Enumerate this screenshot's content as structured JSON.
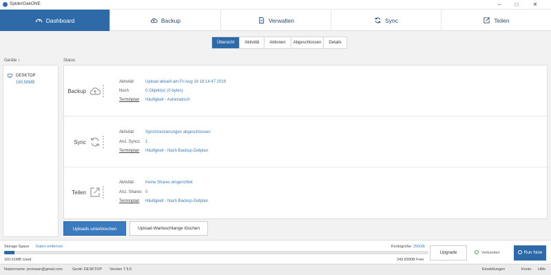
{
  "window": {
    "title": "SpiderOakONE",
    "controls": [
      "–",
      "□",
      "✕"
    ]
  },
  "nav": {
    "tabs": [
      {
        "label": "Dashboard",
        "icon": "dashboard-gauge-icon",
        "active": true
      },
      {
        "label": "Backup",
        "icon": "cloud-upload-icon",
        "active": false
      },
      {
        "label": "Verwalten",
        "icon": "document-icon",
        "active": false
      },
      {
        "label": "Sync",
        "icon": "sync-arrows-icon",
        "active": false
      },
      {
        "label": "Teilen",
        "icon": "share-external-icon",
        "active": false
      }
    ]
  },
  "subtabs": [
    {
      "label": "Übersicht",
      "active": true
    },
    {
      "label": "Aktivität",
      "active": false
    },
    {
      "label": "Aktionen",
      "active": false
    },
    {
      "label": "Abgeschlossen",
      "active": false
    },
    {
      "label": "Details",
      "active": false
    }
  ],
  "devices": {
    "header": "Geräte ↕",
    "items": [
      {
        "name": "DESKTOP",
        "size": "160,58MB",
        "icon": "desktop-device-icon"
      }
    ]
  },
  "status": {
    "header": "Status",
    "sections": [
      {
        "label": "Backup",
        "icon": "cloud-upload-icon",
        "rows": [
          {
            "key": "Aktivität",
            "value": "Upload aktuell am Fri Aug 16 18:14:47 2019",
            "link": false
          },
          {
            "key": "Noch",
            "value": "0 Objekt(e) (0 bytes)",
            "link": false
          },
          {
            "key": "Terminplan",
            "value": "Häufigkeit - Automatisch",
            "link": true
          }
        ]
      },
      {
        "label": "Sync",
        "icon": "sync-arrows-icon",
        "rows": [
          {
            "key": "Aktivität",
            "value": "Synchronisierungen abgeschlossen",
            "link": false
          },
          {
            "key": "Anz. Syncs",
            "value": "1",
            "link": false
          },
          {
            "key": "Terminplan",
            "value": "Häufigkeit - Nach Backup-Zeitplan",
            "link": true
          }
        ]
      },
      {
        "label": "Teilen",
        "icon": "share-external-icon",
        "rows": [
          {
            "key": "Aktivität",
            "value": "Keine Shares eingerichtet",
            "link": false
          },
          {
            "key": "Anz. Shares",
            "value": "0",
            "link": false
          },
          {
            "key": "Terminplan",
            "value": "Häufigkeit - Nach Backup-Zeitplan",
            "link": true
          }
        ]
      }
    ]
  },
  "actions": {
    "pause_uploads": "Uploads unterbrechen",
    "clear_queue": "Upload-Warteschlange löschen"
  },
  "storage": {
    "label": "Storage Space",
    "remove_link": "Daten entfernen",
    "quota_label": "Kontogröße:",
    "quota_value": "250GB",
    "used": "160.61MB Used",
    "free": "249.8390B Free",
    "used_fraction": 0.003,
    "upgrade_label": "Upgrade",
    "connection_status": "Verbunden",
    "run_now_label": "Run Now"
  },
  "footer": {
    "username": "Nutzername: pronwan@gmail.com",
    "device": "Gerät: DESKTOP",
    "version": "Version 7.5.0",
    "links": [
      "Einstellungen",
      "Konto",
      "Hilfe"
    ]
  },
  "colors": {
    "accent": "#2f6aa8",
    "link": "#3a7bc0",
    "connected": "#3c9a3c"
  }
}
